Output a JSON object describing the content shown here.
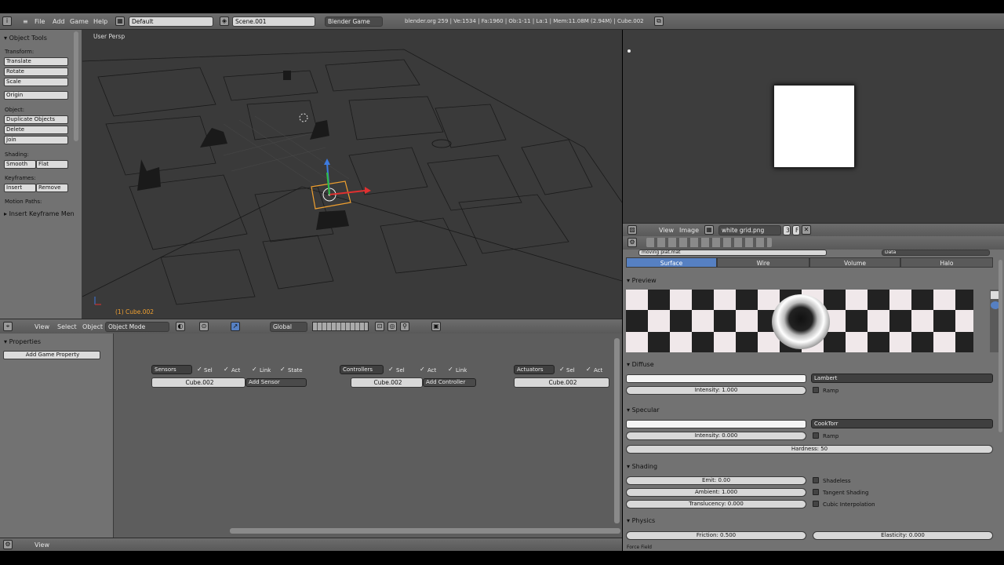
{
  "topbar": {
    "menus": [
      "File",
      "Add",
      "Game",
      "Help"
    ],
    "layout": "Default",
    "scene": "Scene.001",
    "engine": "Blender Game",
    "info": "blender.org 259 | Ve:1534 | Fa:1960 | Ob:1-11 | La:1 | Mem:11.08M (2.94M) | Cube.002"
  },
  "toolshelf": {
    "title": "Object Tools",
    "transform_label": "Transform:",
    "translate": "Translate",
    "rotate": "Rotate",
    "scale": "Scale",
    "origin": "Origin",
    "object_label": "Object:",
    "duplicate": "Duplicate Objects",
    "delete": "Delete",
    "join": "Join",
    "shading_label": "Shading:",
    "smooth": "Smooth",
    "flat": "Flat",
    "keyframes_label": "Keyframes:",
    "insert": "Insert",
    "remove": "Remove",
    "motion_label": "Motion Paths:",
    "insert_keyframe_menu": "Insert Keyframe Men"
  },
  "viewport": {
    "view_name": "User Persp",
    "object_name": "(1) Cube.002"
  },
  "vp_header": {
    "view": "View",
    "select": "Select",
    "object": "Object",
    "mode": "Object Mode",
    "orientation": "Global"
  },
  "logic": {
    "properties_title": "Properties",
    "add_game_property": "Add Game Property",
    "sensors": "Sensors",
    "controllers": "Controllers",
    "actuators": "Actuators",
    "sel": "Sel",
    "act": "Act",
    "link": "Link",
    "state": "State",
    "object_name": "Cube.002",
    "add_sensor": "Add Sensor",
    "add_controller": "Add Controller"
  },
  "bottombar": {
    "view": "View"
  },
  "image_editor": {
    "view": "View",
    "image": "Image",
    "image_name": "white grid.png",
    "users": "3",
    "fake": "F"
  },
  "props": {
    "material_name": "moving plat.mat",
    "data_label": "Data",
    "tabs": [
      "Surface",
      "Wire",
      "Volume",
      "Halo"
    ],
    "preview": "Preview",
    "diffuse": "Diffuse",
    "diffuse_shader": "Lambert",
    "diffuse_intensity": "Intensity: 1.000",
    "ramp": "Ramp",
    "specular": "Specular",
    "specular_shader": "CookTorr",
    "specular_intensity": "Intensity: 0.000",
    "hardness": "Hardness: 50",
    "shading": "Shading",
    "emit": "Emit: 0.00",
    "ambient": "Ambient: 1.000",
    "translucency": "Translucency: 0.000",
    "shadeless": "Shadeless",
    "tangent": "Tangent Shading",
    "cubic": "Cubic Interpolation",
    "physics": "Physics",
    "friction": "Friction: 0.500",
    "elasticity": "Elasticity: 0.000",
    "force_field": "Force Field"
  },
  "colors": {
    "active_tab": "#5680c2",
    "selection_orange": "#f0a030",
    "viewport_bg": "#3a3a3a"
  }
}
